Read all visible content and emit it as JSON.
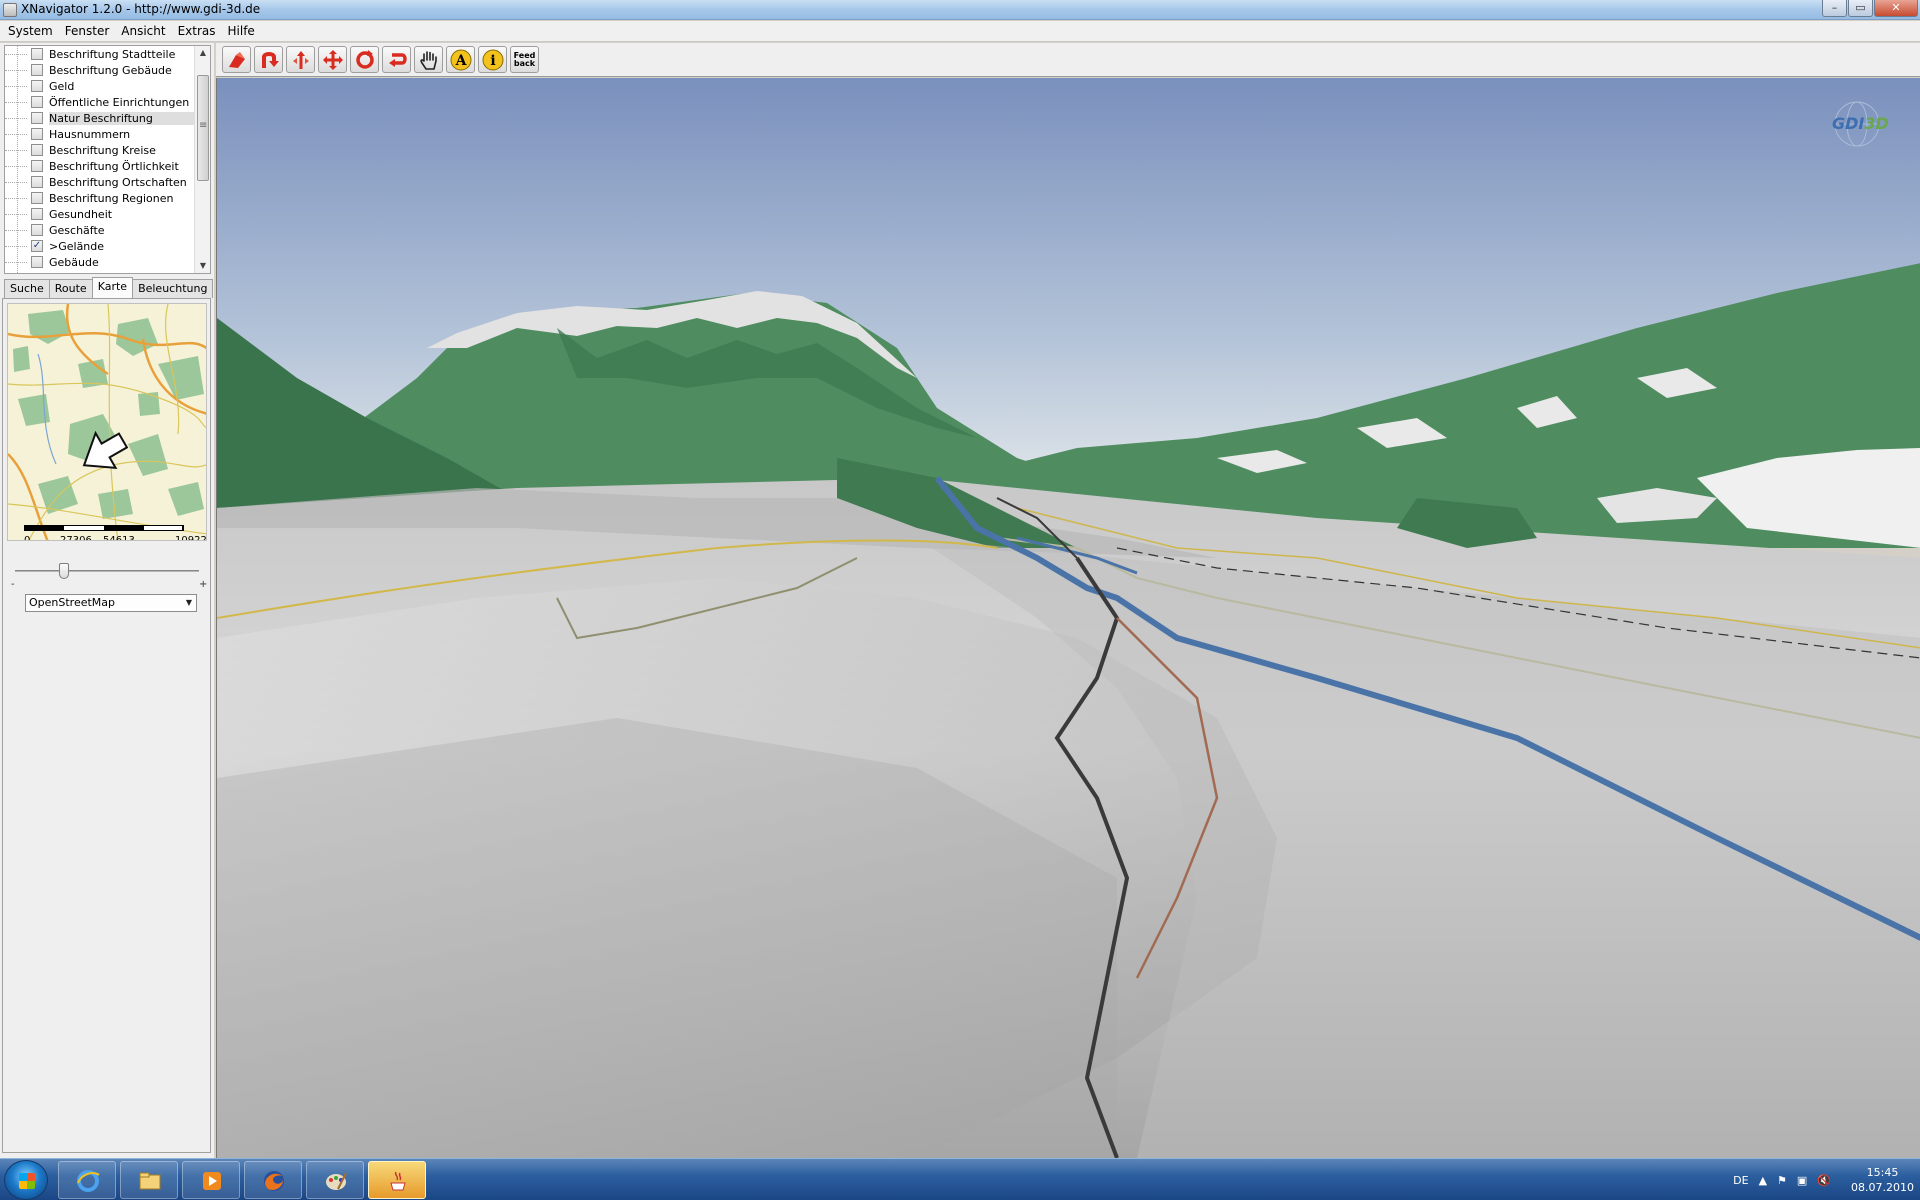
{
  "window": {
    "title": "XNavigator 1.2.0 - http://www.gdi-3d.de",
    "minimize": "–",
    "maximize": "▭",
    "close": "✕"
  },
  "menu": [
    "System",
    "Fenster",
    "Ansicht",
    "Extras",
    "Hilfe"
  ],
  "layers": [
    {
      "label": "Beschriftung Stadtteile",
      "checked": false
    },
    {
      "label": "Beschriftung Gebäude",
      "checked": false
    },
    {
      "label": "Geld",
      "checked": false
    },
    {
      "label": "Öffentliche Einrichtungen",
      "checked": false
    },
    {
      "label": "Natur Beschriftung",
      "checked": false,
      "selected": true
    },
    {
      "label": "Hausnummern",
      "checked": false
    },
    {
      "label": "Beschriftung Kreise",
      "checked": false
    },
    {
      "label": "Beschriftung Örtlichkeit",
      "checked": false
    },
    {
      "label": "Beschriftung Ortschaften",
      "checked": false
    },
    {
      "label": "Beschriftung Regionen",
      "checked": false
    },
    {
      "label": "Gesundheit",
      "checked": false
    },
    {
      "label": "Geschäfte",
      "checked": false
    },
    {
      "label": ">Gelände",
      "checked": true
    },
    {
      "label": "Gebäude",
      "checked": false
    }
  ],
  "tabs": [
    "Suche",
    "Route",
    "Karte",
    "Beleuchtung"
  ],
  "active_tab": "Karte",
  "scale": {
    "labels": [
      "0",
      "27306",
      "54613",
      "10922"
    ]
  },
  "zoom": {
    "minus": "-",
    "plus": "+",
    "level": 0.25
  },
  "map_source": "OpenStreetMap",
  "toolbar": {
    "icons": [
      "fly-up-icon",
      "rotate-up-icon",
      "move-icon",
      "pan-icon",
      "rotate-icon",
      "undo-icon",
      "hand-icon",
      "label-icon",
      "info-icon"
    ],
    "label_glyph": "A",
    "info_glyph": "i",
    "feedback_label_1": "Feed",
    "feedback_label_2": "back"
  },
  "logo": {
    "text_a": "GDI",
    "text_b": "3D"
  },
  "taskbar": {
    "apps": [
      "internet-explorer-icon",
      "explorer-icon",
      "media-player-icon",
      "firefox-icon",
      "paint-icon",
      "java-icon"
    ],
    "language": "DE",
    "time": "15:45",
    "date": "08.07.2010"
  },
  "colors": {
    "accent": "#2c5fa0",
    "terrain_green": "#4e8a5c",
    "terrain_snow": "#e9e9e9"
  }
}
